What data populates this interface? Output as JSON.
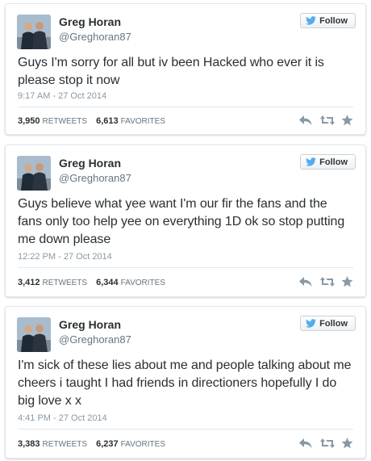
{
  "tweets": [
    {
      "name": "Greg Horan",
      "handle": "@Greghoran87",
      "follow_label": "Follow",
      "text": "Guys I'm sorry for all but iv been Hacked who ever it is please stop it now",
      "time": "9:17 AM - 27 Oct 2014",
      "retweets": "3,950",
      "retweets_label": "RETWEETS",
      "favorites": "6,613",
      "favorites_label": "FAVORITES"
    },
    {
      "name": "Greg Horan",
      "handle": "@Greghoran87",
      "follow_label": "Follow",
      "text": "Guys believe what yee want I'm our fir the fans and the fans only too help yee on everything 1D ok so stop putting me down please",
      "time": "12:22 PM - 27 Oct 2014",
      "retweets": "3,412",
      "retweets_label": "RETWEETS",
      "favorites": "6,344",
      "favorites_label": "FAVORITES"
    },
    {
      "name": "Greg Horan",
      "handle": "@Greghoran87",
      "follow_label": "Follow",
      "text": "I'm sick of these lies about me and people talking about me cheers i taught I had friends in directioners hopefully I do big love x x",
      "time": "4:41 PM - 27 Oct 2014",
      "retweets": "3,383",
      "retweets_label": "RETWEETS",
      "favorites": "6,237",
      "favorites_label": "FAVORITES"
    }
  ],
  "icons": {
    "follow": "twitter-bird-icon",
    "reply": "reply-icon",
    "retweet": "retweet-icon",
    "favorite": "star-icon"
  },
  "colors": {
    "twitter_blue": "#55acee",
    "action_gray": "#8899a6"
  }
}
